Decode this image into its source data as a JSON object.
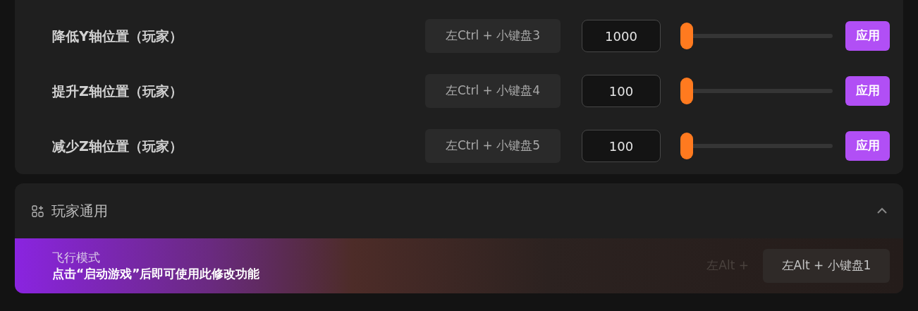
{
  "settings": [
    {
      "label": "降低Y轴位置（玩家）",
      "hotkey": "左Ctrl + 小键盘3",
      "value": "1000",
      "level": 0,
      "button": "应用"
    },
    {
      "label": "提升Z轴位置（玩家）",
      "hotkey": "左Ctrl + 小键盘4",
      "value": "100",
      "level": 0,
      "button": "应用"
    },
    {
      "label": "减少Z轴位置（玩家）",
      "hotkey": "左Ctrl + 小键盘5",
      "value": "100",
      "level": 0,
      "button": "应用"
    }
  ],
  "section": {
    "title": "玩家通用",
    "expanded": true,
    "feature": {
      "name": "飞行模式",
      "notice": "点击“启动游戏”后即可使用此修改功能",
      "faded_hotkey": "左Alt +",
      "hotkey": "左Alt + 小键盘1"
    }
  }
}
